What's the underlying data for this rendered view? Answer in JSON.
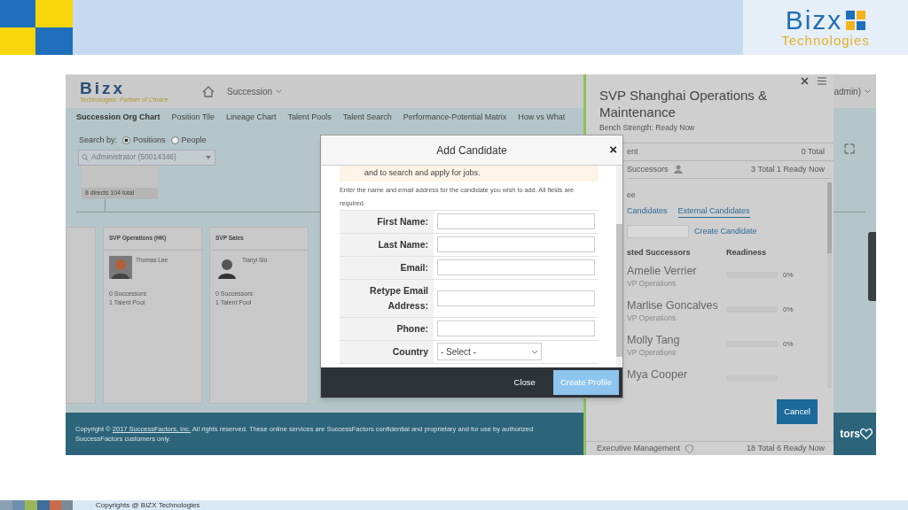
{
  "slide": {
    "logo": {
      "name": "Bizx",
      "subtitle": "Technologies"
    },
    "footer": "Copyrights @ BIZX Technologies"
  },
  "app": {
    "logo": {
      "name": "Bizx",
      "subtitle": "Technologies",
      "motto": "Partner of Choice"
    },
    "module": "Succession",
    "user": "admin)",
    "tabs": [
      {
        "label": "Succession Org Chart",
        "selected": true
      },
      {
        "label": "Position Tile",
        "selected": false
      },
      {
        "label": "Lineage Chart",
        "selected": false
      },
      {
        "label": "Talent Pools",
        "selected": false
      },
      {
        "label": "Talent Search",
        "selected": false
      },
      {
        "label": "Performance-Potential Matrix",
        "selected": false
      },
      {
        "label": "How vs What",
        "selected": false
      }
    ],
    "search": {
      "label": "Search by:",
      "options": [
        {
          "label": "Positions",
          "selected": true
        },
        {
          "label": "People",
          "selected": false
        }
      ],
      "value": "Administrator (50014346)"
    },
    "top_node": {
      "summary": "8 directs 104 total"
    },
    "positions": [
      {
        "title": "SVP Operations (HK)",
        "holder": "Thomas Lee",
        "successors": "0 Successors",
        "pools": "1 Talent Pool"
      },
      {
        "title": "SVP Sales",
        "holder": "Tianyi Sio",
        "successors": "0 Successors",
        "pools": "1 Talent Pool"
      }
    ],
    "footer": {
      "before": "Copyright © ",
      "link": "2017 SuccessFactors, Inc.",
      "after": " All rights reserved. These online services are SuccessFactors confidential and proprietary and for use by authorized SuccessFactors customers only.",
      "right": "tors"
    }
  },
  "panel": {
    "title": "SVP Shanghai Operations & Maintenance",
    "bench": "Bench Strength: Ready Now",
    "rows": [
      {
        "label": "ent",
        "value": "0 Total"
      },
      {
        "label": "Successors",
        "value": "3 Total 1 Ready Now"
      }
    ],
    "section": "ee",
    "tabs": [
      {
        "label": "Candidates",
        "selected": false
      },
      {
        "label": "External Candidates",
        "selected": true
      }
    ],
    "create_link": "Create Candidate",
    "columns": [
      "sted Successors",
      "Readiness"
    ],
    "successors": [
      {
        "name": "Amelie Verrier",
        "role": "VP Operations",
        "level": 0,
        "reading": "0%"
      },
      {
        "name": "Marlise Goncalves",
        "role": "VP Operations",
        "level": 0,
        "reading": "0%"
      },
      {
        "name": "Molly Tang",
        "role": "VP Operations",
        "level": 0,
        "reading": "0%"
      },
      {
        "name": "Mya Cooper",
        "level": 0
      }
    ],
    "cancel": "Cancel",
    "bottom": {
      "label": "Executive Management",
      "value": "18 Total 6 Ready Now"
    }
  },
  "dialog": {
    "title": "Add Candidate",
    "close_glyph": "×",
    "notice": "and to search and apply for jobs.",
    "instructions": "Enter the name and email address for the candidate you wish to add. All fields are required.",
    "fields": [
      {
        "kind": "text",
        "label": "First Name:"
      },
      {
        "kind": "text",
        "label": "Last Name:"
      },
      {
        "kind": "text",
        "label": "Email:"
      },
      {
        "kind": "text",
        "label": "Retype Email Address:"
      },
      {
        "kind": "text",
        "label": "Phone:"
      },
      {
        "kind": "select",
        "label": "Country",
        "value": "- Select -"
      }
    ],
    "buttons": [
      {
        "label": "Close",
        "kind": "secondary"
      },
      {
        "label": "Create Profile",
        "kind": "primary"
      }
    ]
  }
}
